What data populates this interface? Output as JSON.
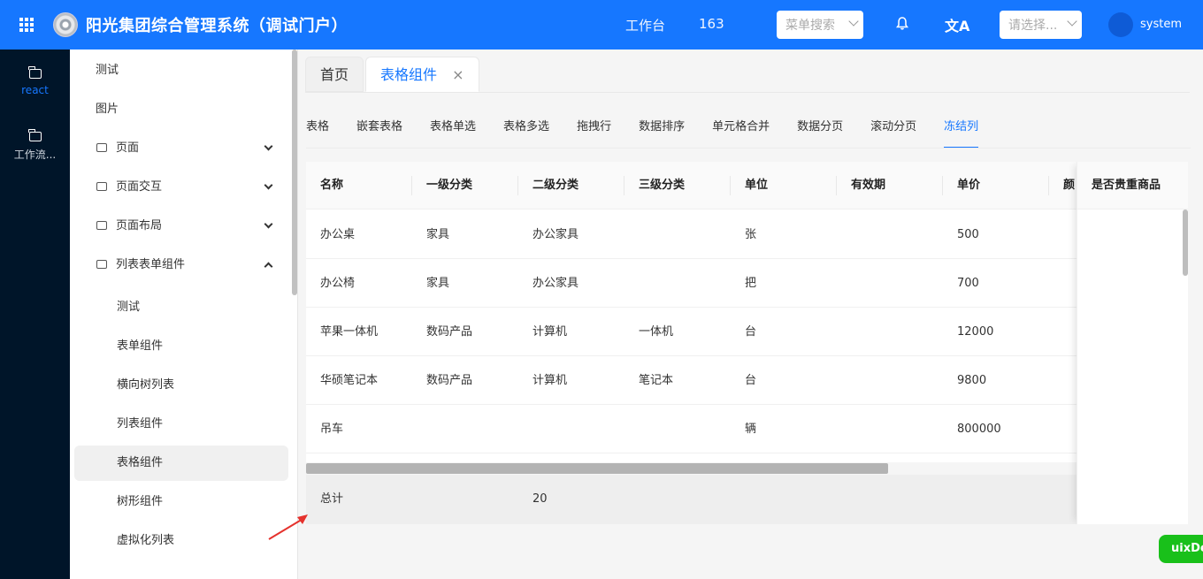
{
  "header": {
    "title": "阳光集团综合管理系统（调试门户）",
    "workbench": "工作台",
    "number": "163",
    "menu_search_placeholder": "菜单搜索",
    "select_placeholder": "请选择...",
    "translate_icon": "文A",
    "username": "system",
    "colors": {
      "primary": "#1677ff"
    }
  },
  "rail": {
    "items": [
      {
        "label": "react",
        "icon": "folder-icon",
        "active": true
      },
      {
        "label": "工作流...",
        "icon": "folder-icon",
        "active": false
      }
    ]
  },
  "submenu": {
    "items": [
      {
        "label": "测试"
      },
      {
        "label": "图片"
      },
      {
        "label": "页面"
      },
      {
        "label": "页面交互"
      },
      {
        "label": "页面布局"
      },
      {
        "label": "列表表单组件"
      },
      {
        "label": "测试"
      },
      {
        "label": "表单组件"
      },
      {
        "label": "横向树列表"
      },
      {
        "label": "列表组件"
      },
      {
        "label": "表格组件"
      },
      {
        "label": "树形组件"
      },
      {
        "label": "虚拟化列表"
      }
    ]
  },
  "page_tabs": [
    {
      "label": "首页"
    },
    {
      "label": "表格组件",
      "close": "×"
    }
  ],
  "sub_tabs": [
    "表格",
    "嵌套表格",
    "表格单选",
    "表格多选",
    "拖拽行",
    "数据排序",
    "单元格合并",
    "数据分页",
    "滚动分页",
    "冻结列"
  ],
  "table": {
    "columns": [
      "名称",
      "一级分类",
      "二级分类",
      "三级分类",
      "单位",
      "有效期",
      "单价",
      "颜"
    ],
    "frozen_column": "是否贵重商品",
    "rows": [
      [
        "办公桌",
        "家具",
        "办公家具",
        "",
        "张",
        "",
        "500"
      ],
      [
        "办公椅",
        "家具",
        "办公家具",
        "",
        "把",
        "",
        "700"
      ],
      [
        "苹果一体机",
        "数码产品",
        "计算机",
        "一体机",
        "台",
        "",
        "12000"
      ],
      [
        "华硕笔记本",
        "数码产品",
        "计算机",
        "笔记本",
        "台",
        "",
        "9800"
      ],
      [
        "吊车",
        "",
        "",
        "",
        "辆",
        "",
        "800000"
      ]
    ],
    "summary": {
      "label": "总计",
      "value": "20"
    }
  },
  "floating_button": "uixDev"
}
